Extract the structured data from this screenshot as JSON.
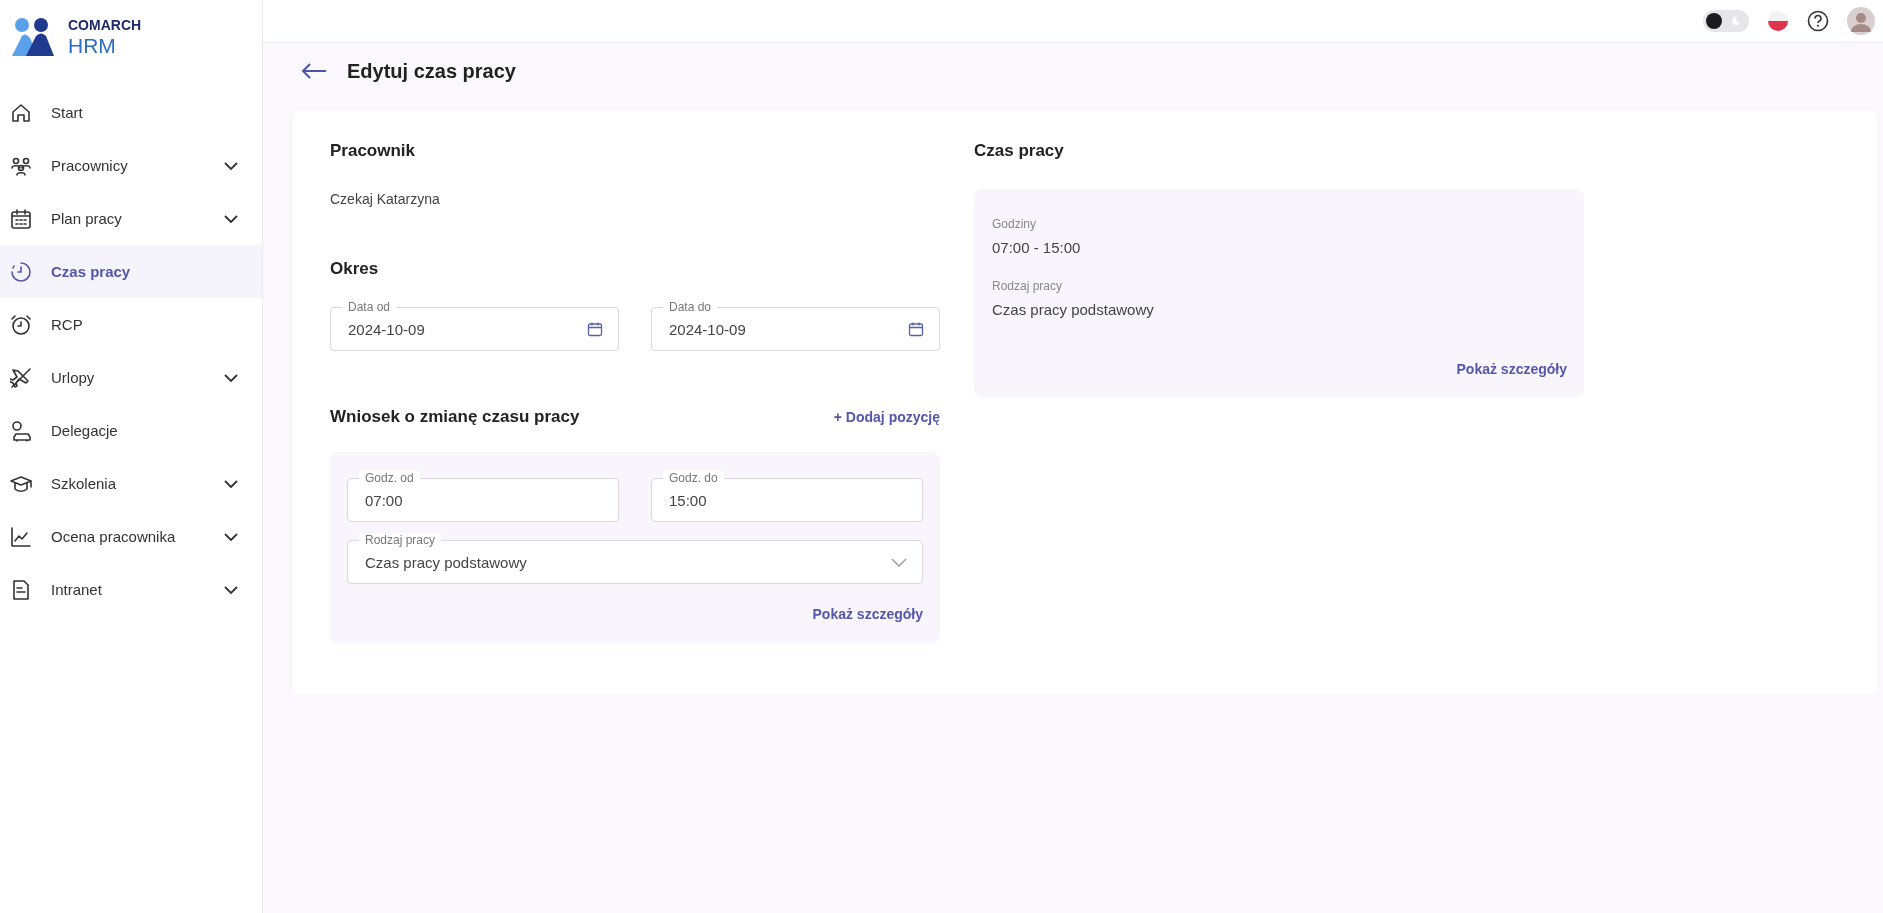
{
  "brand": {
    "line1": "COMARCH",
    "line2": "HRM"
  },
  "sidebar": {
    "items": [
      {
        "label": "Start",
        "expandable": false,
        "selected": false
      },
      {
        "label": "Pracownicy",
        "expandable": true,
        "selected": false
      },
      {
        "label": "Plan pracy",
        "expandable": true,
        "selected": false
      },
      {
        "label": "Czas pracy",
        "expandable": false,
        "selected": true
      },
      {
        "label": "RCP",
        "expandable": false,
        "selected": false
      },
      {
        "label": "Urlopy",
        "expandable": true,
        "selected": false
      },
      {
        "label": "Delegacje",
        "expandable": false,
        "selected": false
      },
      {
        "label": "Szkolenia",
        "expandable": true,
        "selected": false
      },
      {
        "label": "Ocena pracownika",
        "expandable": true,
        "selected": false
      },
      {
        "label": "Intranet",
        "expandable": true,
        "selected": false
      }
    ]
  },
  "topbar": {
    "theme_toggle": {
      "on": false
    }
  },
  "page_title": "Edytuj czas pracy",
  "employee": {
    "heading": "Pracownik",
    "name": "Czekaj Katarzyna"
  },
  "period": {
    "heading": "Okres",
    "fields": [
      {
        "label": "Data od",
        "value": "2024-10-09"
      },
      {
        "label": "Data do",
        "value": "2024-10-09"
      }
    ]
  },
  "request": {
    "heading": "Wniosek o zmianę czasu pracy",
    "add_link": "+ Dodaj pozycję",
    "fields": [
      {
        "label": "Godz. od",
        "value": "07:00"
      },
      {
        "label": "Godz. do",
        "value": "15:00"
      }
    ],
    "select": {
      "label": "Rodzaj pracy",
      "value": "Czas pracy podstawowy"
    },
    "details_link": "Pokaż szczegóły"
  },
  "work_time": {
    "heading": "Czas pracy",
    "items": [
      {
        "label": "Godziny",
        "value": "07:00 - 15:00"
      },
      {
        "label": "Rodzaj pracy",
        "value": "Czas pracy podstawowy"
      }
    ],
    "details_link": "Pokaż szczegóły"
  }
}
